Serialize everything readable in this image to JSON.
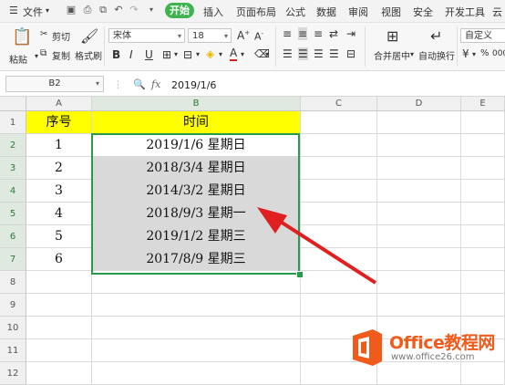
{
  "menu": {
    "file": "文件",
    "start": "开始",
    "tabs": [
      "插入",
      "页面布局",
      "公式",
      "数据",
      "审阅",
      "视图",
      "安全",
      "开发工具",
      "云"
    ]
  },
  "ribbon": {
    "paste": "粘贴",
    "cut": "剪切",
    "copy": "复制",
    "format_painter": "格式刷",
    "font": "宋体",
    "size": "18",
    "merge": "合并居中",
    "wrap": "自动换行",
    "number_format": "自定义",
    "percent": "%",
    "thousands": "000"
  },
  "formula_bar": {
    "name_box": "B2",
    "fx": "fx",
    "value": "2019/1/6"
  },
  "columns": [
    "A",
    "B",
    "C",
    "D",
    "E"
  ],
  "rows": [
    "1",
    "2",
    "3",
    "4",
    "5",
    "6",
    "7",
    "8",
    "9",
    "10",
    "11",
    "12"
  ],
  "sheet": {
    "header": {
      "a": "序号",
      "b": "时间"
    },
    "data": [
      {
        "a": "1",
        "b": "2019/1/6  星期日"
      },
      {
        "a": "2",
        "b": "2018/3/4  星期日"
      },
      {
        "a": "3",
        "b": "2014/3/2  星期日"
      },
      {
        "a": "4",
        "b": "2018/9/3  星期一"
      },
      {
        "a": "5",
        "b": "2019/1/2  星期三"
      },
      {
        "a": "6",
        "b": "2017/8/9  星期三"
      }
    ]
  },
  "watermark": {
    "brand": "Office教程网",
    "url": "www.office26.com"
  },
  "colors": {
    "accent": "#3fb34f",
    "header_fill": "#ffff00",
    "selection_border": "#2a9a4a",
    "arrow": "#e02020",
    "logo_orange": "#f05a1a"
  }
}
